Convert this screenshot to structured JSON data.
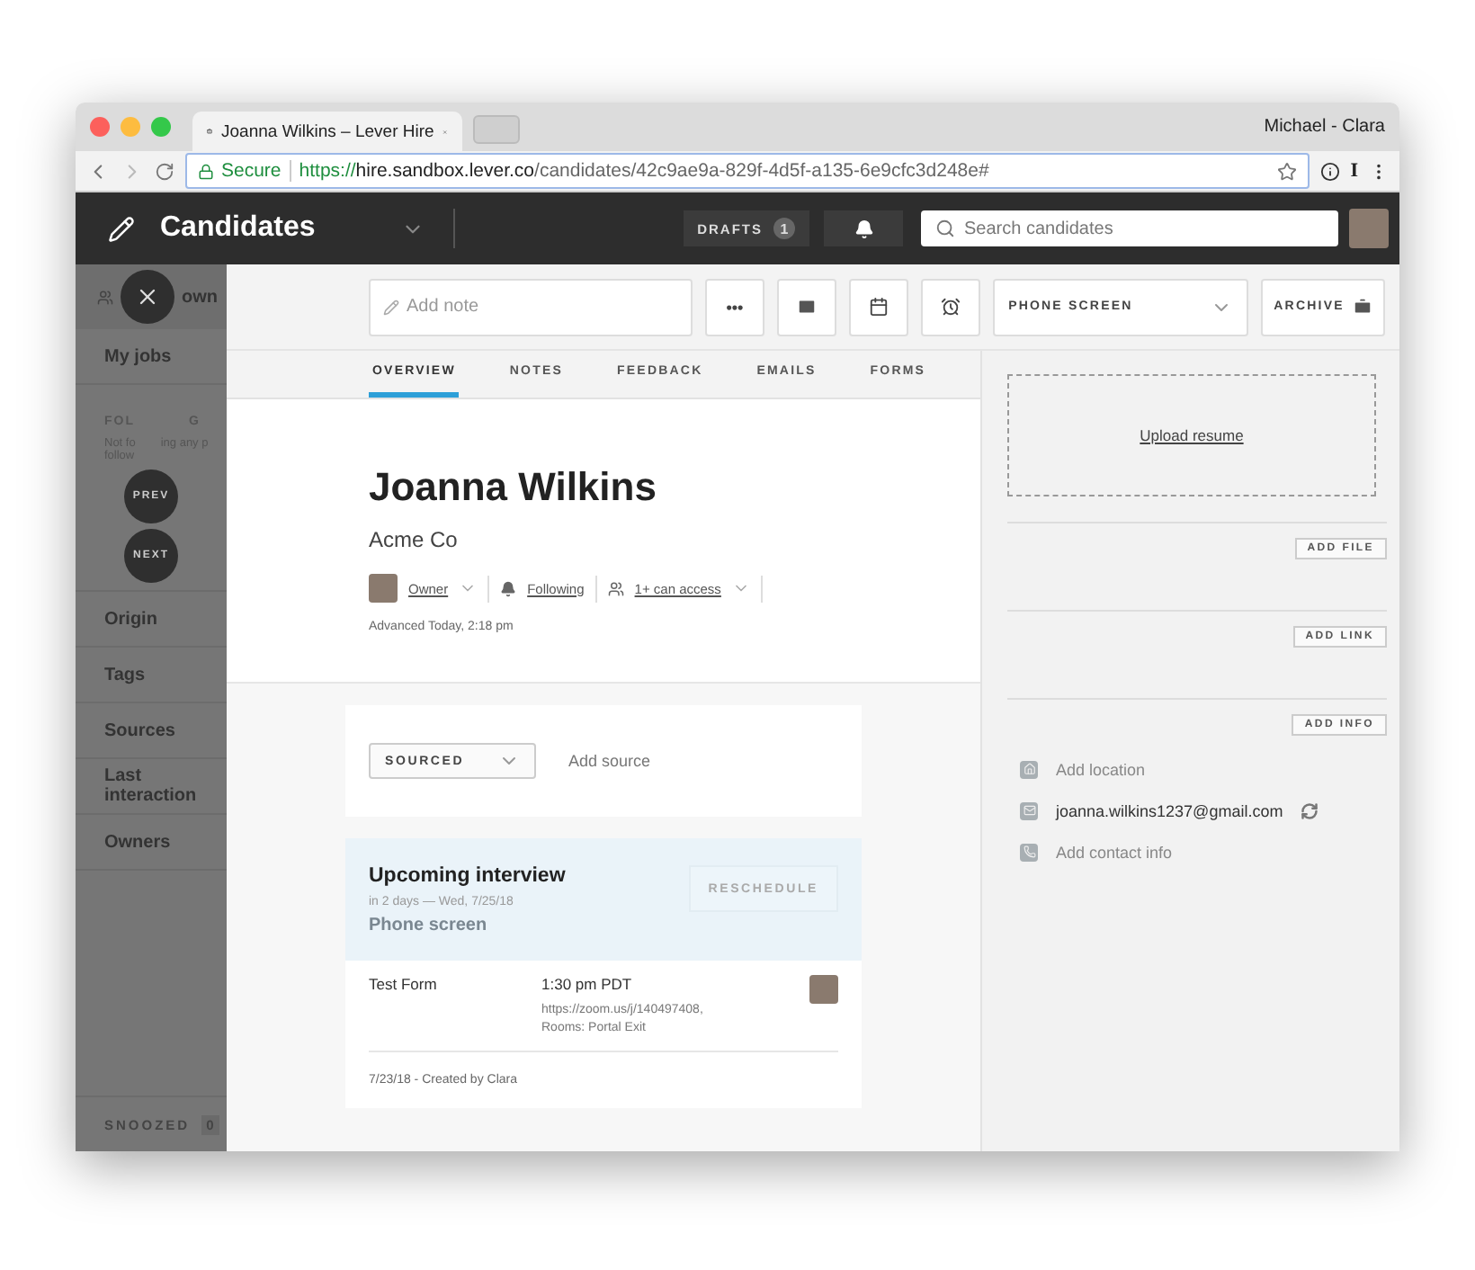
{
  "browser": {
    "tab_title": "Joanna Wilkins – Lever Hire",
    "profile": "Michael - Clara",
    "secure_label": "Secure",
    "url_scheme": "https://",
    "url_host": "hire.sandbox.lever.co",
    "url_path": "/candidates/42c9ae9a-829f-4d5f-a135-6e9cfc3d248e#",
    "extension": "I"
  },
  "header": {
    "title": "Candidates",
    "drafts_label": "DRAFTS",
    "drafts_count": "1",
    "search_placeholder": "Search candidates"
  },
  "sidebar": {
    "owner_item": "own",
    "jobs_item": "My jobs",
    "following_head_left": "FOL",
    "following_head_right": "G",
    "following_note_left": "Not fo",
    "following_note_right": "ing any p",
    "following_note_line2": "follow",
    "filters": [
      "Origin",
      "Tags",
      "Sources",
      "Last interaction",
      "Owners"
    ],
    "snoozed_label": "SNOOZED",
    "snoozed_count": "0"
  },
  "overlay": {
    "prev": "PREV",
    "next": "NEXT"
  },
  "toolbar": {
    "note_placeholder": "Add note",
    "more": "•••",
    "stage": "PHONE SCREEN",
    "archive": "ARCHIVE"
  },
  "tabs": [
    {
      "label": "OVERVIEW",
      "selected": true
    },
    {
      "label": "NOTES",
      "selected": false
    },
    {
      "label": "FEEDBACK",
      "selected": false
    },
    {
      "label": "EMAILS",
      "selected": false
    },
    {
      "label": "FORMS",
      "selected": false
    }
  ],
  "candidate": {
    "name": "Joanna Wilkins",
    "company": "Acme Co",
    "owner": "Owner",
    "following": "Following",
    "access": "1+ can access",
    "advanced": "Advanced Today, 2:18 pm"
  },
  "source": {
    "origin": "SOURCED",
    "add_source": "Add source"
  },
  "interview": {
    "title": "Upcoming interview",
    "when": "in 2 days — Wed, 7/25/18",
    "type": "Phone screen",
    "reschedule": "RESCHEDULE",
    "form": "Test Form",
    "time": "1:30 pm PDT",
    "location": "https://zoom.us/j/140497408, Rooms: Portal Exit",
    "footer": "7/23/18 - Created by Clara"
  },
  "resume": {
    "upload": "Upload resume",
    "buttons": [
      "ADD FILE",
      "ADD LINK",
      "ADD INFO"
    ]
  },
  "contacts": [
    {
      "kind": "location",
      "text": "Add location",
      "filled": false
    },
    {
      "kind": "email",
      "text": "joanna.wilkins1237@gmail.com",
      "filled": true
    },
    {
      "kind": "phone",
      "text": "Add contact info",
      "filled": false
    }
  ]
}
